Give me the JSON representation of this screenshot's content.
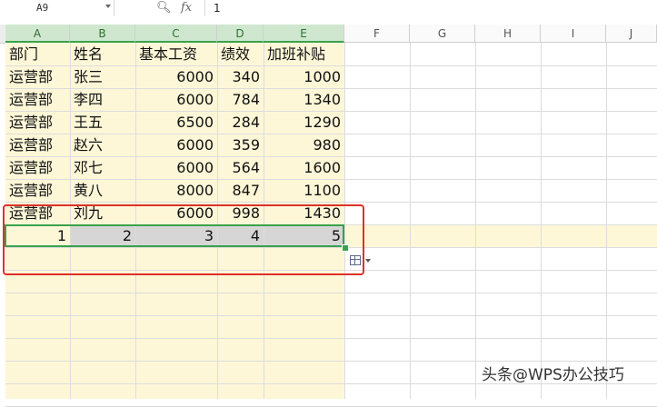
{
  "formula_bar": {
    "name_box": "A9",
    "fx_label": "fx",
    "formula_value": "1"
  },
  "columns": [
    "A",
    "B",
    "C",
    "D",
    "E",
    "F",
    "G",
    "H",
    "I",
    "J"
  ],
  "rows": [
    [
      "部门",
      "姓名",
      "基本工资",
      "绩效",
      "加班补贴"
    ],
    [
      "运营部",
      "张三",
      "6000",
      "340",
      "1000"
    ],
    [
      "运营部",
      "李四",
      "6000",
      "784",
      "1340"
    ],
    [
      "运营部",
      "王五",
      "6500",
      "284",
      "1290"
    ],
    [
      "运营部",
      "赵六",
      "6000",
      "359",
      "980"
    ],
    [
      "运营部",
      "邓七",
      "6000",
      "564",
      "1600"
    ],
    [
      "运营部",
      "黄八",
      "8000",
      "847",
      "1100"
    ],
    [
      "运营部",
      "刘九",
      "6000",
      "998",
      "1430"
    ],
    [
      "1",
      "2",
      "3",
      "4",
      "5"
    ]
  ],
  "watermark": "头条@WPS办公技巧",
  "colors": {
    "selection_border": "#3aa14b",
    "highlight_fill": "#fdf7d8",
    "annotation_red": "#e03028"
  }
}
